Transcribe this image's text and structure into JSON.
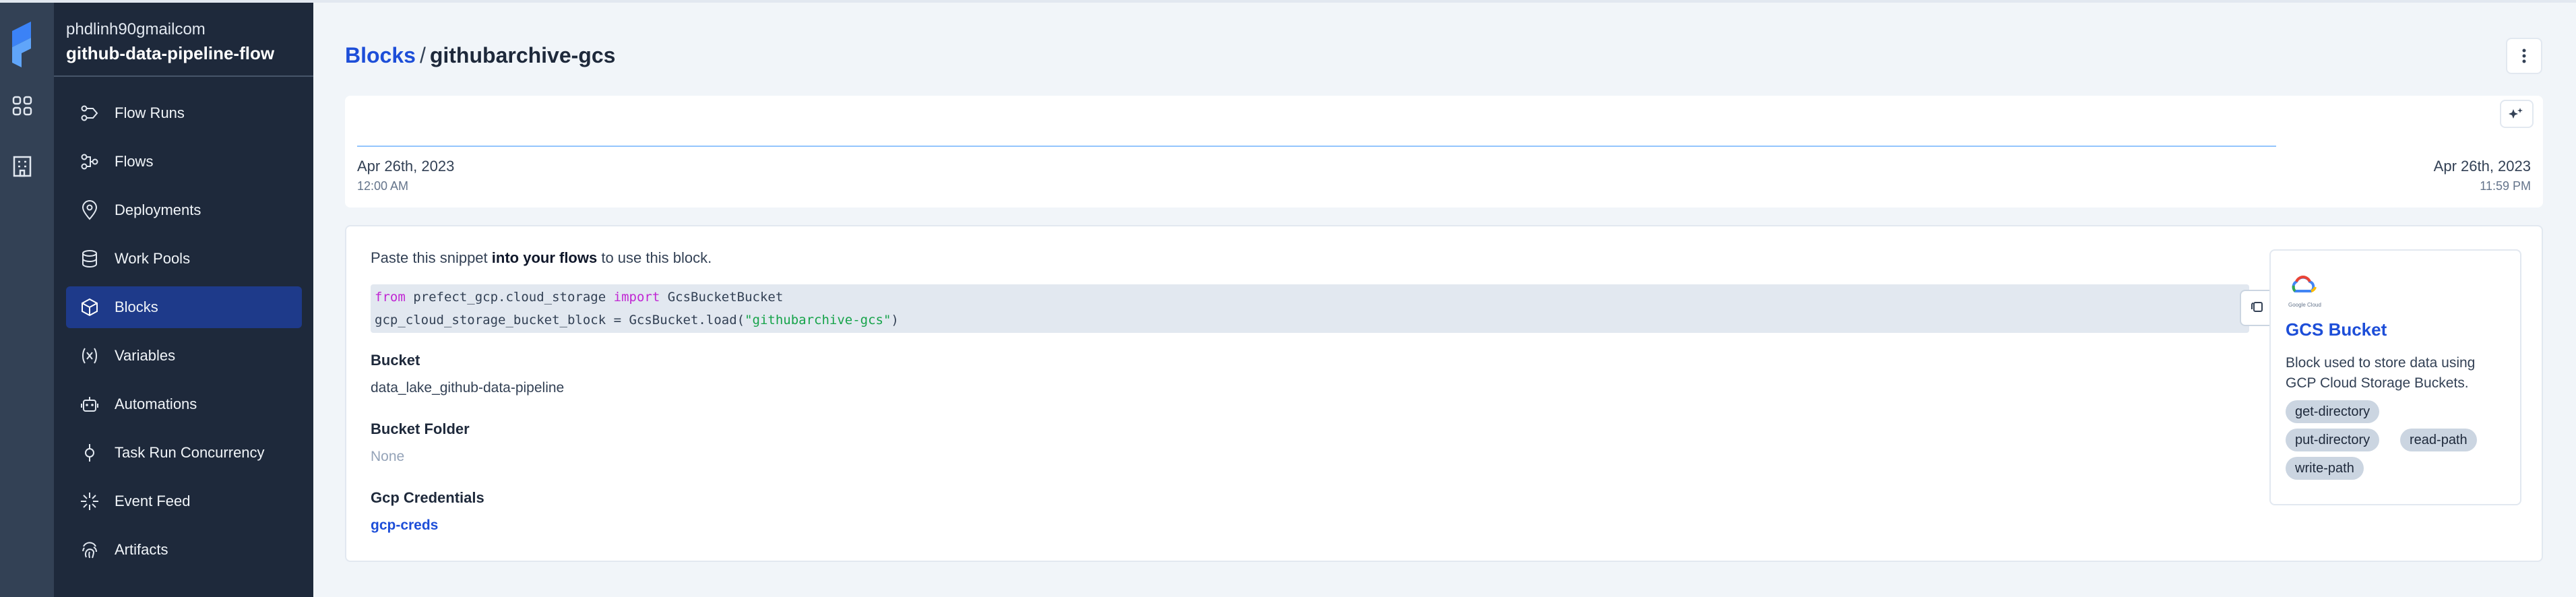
{
  "workspace": {
    "user": "phdlinh90gmailcom",
    "name": "github-data-pipeline-flow"
  },
  "rail": {
    "icons": [
      "prefect-logo-icon",
      "dashboard-grid-icon",
      "building-icon"
    ]
  },
  "sidebar": {
    "items": [
      {
        "label": "Flow Runs",
        "icon": "flow-runs-icon",
        "active": false
      },
      {
        "label": "Flows",
        "icon": "flows-icon",
        "active": false
      },
      {
        "label": "Deployments",
        "icon": "location-pin-icon",
        "active": false
      },
      {
        "label": "Work Pools",
        "icon": "database-icon",
        "active": false
      },
      {
        "label": "Blocks",
        "icon": "cube-icon",
        "active": true
      },
      {
        "label": "Variables",
        "icon": "variable-icon",
        "active": false
      },
      {
        "label": "Automations",
        "icon": "robot-icon",
        "active": false
      },
      {
        "label": "Task Run Concurrency",
        "icon": "concurrency-icon",
        "active": false
      },
      {
        "label": "Event Feed",
        "icon": "event-feed-icon",
        "active": false
      },
      {
        "label": "Artifacts",
        "icon": "fingerprint-icon",
        "active": false
      }
    ]
  },
  "header": {
    "breadcrumb_link": "Blocks",
    "separator": "/",
    "current": "githubarchive-gcs"
  },
  "timeline": {
    "start_date": "Apr 26th, 2023",
    "start_time": "12:00 AM",
    "end_date": "Apr 26th, 2023",
    "end_time": "11:59 PM"
  },
  "snippet": {
    "intro_before": "Paste this snippet ",
    "intro_bold": "into your flows",
    "intro_after": " to use this block.",
    "line1": {
      "kw_from": "from",
      "module": " prefect_gcp.cloud_storage ",
      "kw_import": "import",
      "name": " GcsBucketBucket"
    },
    "line2": {
      "prefix": "gcp_cloud_storage_bucket_block = GcsBucket.load(",
      "string": "\"githubarchive-gcs\"",
      "suffix": ")"
    }
  },
  "fields": [
    {
      "label": "Bucket",
      "value": "data_lake_github-data-pipeline"
    },
    {
      "label": "Bucket Folder",
      "value": "None"
    },
    {
      "label": "Gcp Credentials",
      "value": "gcp-creds"
    }
  ],
  "block_type": {
    "logo_caption": "Google Cloud",
    "name": "GCS Bucket",
    "description": "Block used to store data using GCP Cloud Storage Buckets.",
    "capabilities": [
      "get-directory",
      "put-directory",
      "read-path",
      "write-path"
    ]
  },
  "colors": {
    "accent": "#1d4ed8",
    "sidebar_bg": "#1e293b",
    "rail_bg": "#334155",
    "active_bg": "#1e3a8a"
  }
}
